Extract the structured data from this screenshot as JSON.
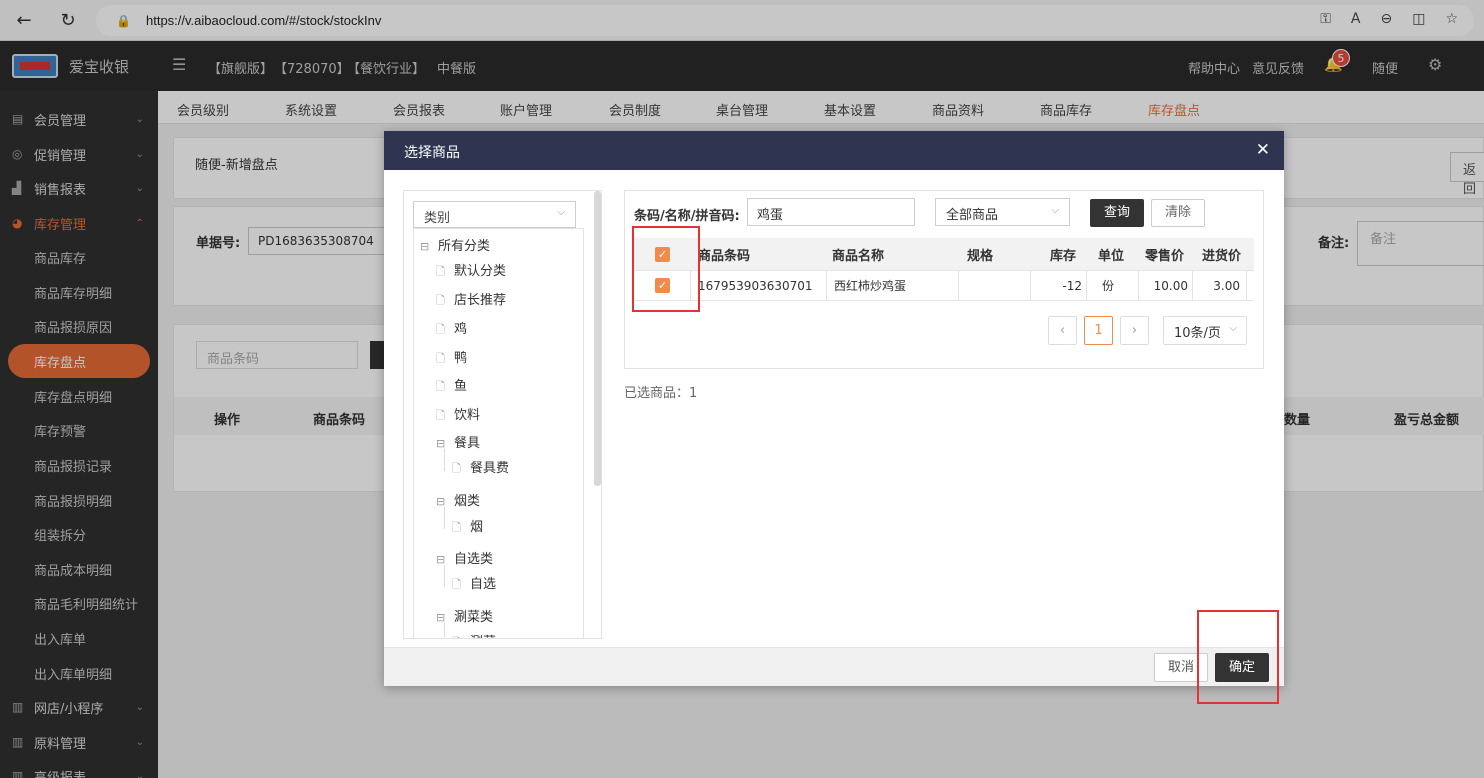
{
  "browser": {
    "url": "https://v.aibaocloud.com/#/stock/stockInv"
  },
  "header": {
    "app_name": "爱宝收银",
    "tags": [
      "【旗舰版】",
      "【728070】",
      "【餐饮行业】",
      "中餐版"
    ],
    "help": "帮助中心",
    "feedback": "意见反馈",
    "notification_count": "5",
    "user": "随便"
  },
  "sidebar": {
    "groups": [
      {
        "label": "会员管理"
      },
      {
        "label": "促销管理"
      },
      {
        "label": "销售报表"
      },
      {
        "label": "库存管理"
      },
      {
        "label": "网店/小程序"
      },
      {
        "label": "原料管理"
      },
      {
        "label": "高级报表"
      }
    ],
    "items": [
      "商品库存",
      "商品库存明细",
      "商品报损原因",
      "库存盘点",
      "库存盘点明细",
      "库存预警",
      "商品报损记录",
      "商品报损明细",
      "组装拆分",
      "商品成本明细",
      "商品毛利明细统计",
      "出入库单",
      "出入库单明细"
    ]
  },
  "tabs": [
    "会员级别",
    "系统设置",
    "会员报表",
    "账户管理",
    "会员制度",
    "桌台管理",
    "基本设置",
    "商品资料",
    "商品库存",
    "库存盘点"
  ],
  "page": {
    "title": "随便-新增盘点",
    "return_label": "返回",
    "doc_no_label": "单据号:",
    "doc_no_value": "PD1683635308704",
    "remark_label": "备注:",
    "remark_placeholder": "备注",
    "barcode_placeholder": "商品条码",
    "table_headers": [
      "操作",
      "商品条码",
      "数量",
      "盈亏总金额"
    ]
  },
  "modal": {
    "title": "选择商品",
    "close": "✕",
    "category_select": "类别",
    "tree": {
      "root": "所有分类",
      "nodes": [
        "默认分类",
        "店长推荐",
        "鸡",
        "鸭",
        "鱼",
        "饮料",
        "餐具",
        "餐具费",
        "烟类",
        "烟",
        "自选类",
        "自选",
        "涮菜类",
        "涮菜"
      ]
    },
    "search_label": "条码/名称/拼音码:",
    "search_value": "鸡蛋",
    "filter_value": "全部商品",
    "query_btn": "查询",
    "clear_btn": "清除",
    "columns": [
      "商品条码",
      "商品名称",
      "规格",
      "库存",
      "单位",
      "零售价",
      "进货价"
    ],
    "rows": [
      {
        "barcode": "167953903630701",
        "name": "西红柿炒鸡蛋",
        "spec": "",
        "stock": "-12",
        "unit": "份",
        "retail": "10.00",
        "cost": "3.00"
      }
    ],
    "page_current": "1",
    "page_size": "10条/页",
    "selected_label": "已选商品：1",
    "cancel_btn": "取消",
    "ok_btn": "确定"
  },
  "colors": {
    "accent": "#e66b36",
    "header_bg": "#2b2b2b",
    "modal_head": "#2f3550",
    "highlight": "#e53333"
  }
}
